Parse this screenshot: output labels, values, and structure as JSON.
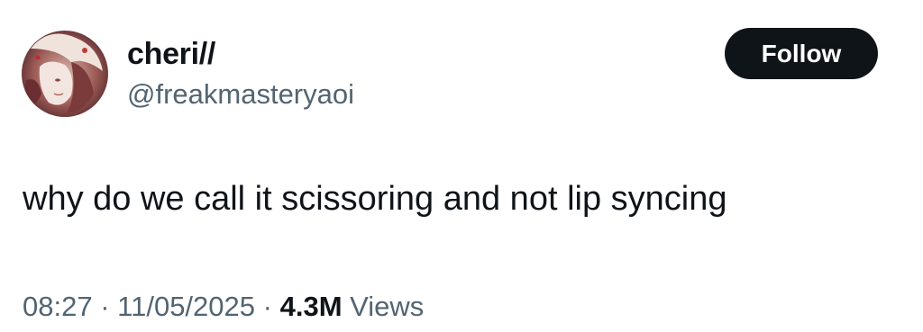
{
  "user": {
    "display_name": "cheri//",
    "handle": "@freakmasteryaoi"
  },
  "follow_button": {
    "label": "Follow"
  },
  "post": {
    "text": "why do we call it scissoring and not lip syncing"
  },
  "meta": {
    "time": "08:27",
    "separator": "·",
    "date": "11/05/2025",
    "views_count": "4.3M",
    "views_label": "Views"
  },
  "colors": {
    "text_primary": "#0f1419",
    "text_secondary": "#536471",
    "button_background": "#0f1419",
    "button_text": "#ffffff"
  }
}
